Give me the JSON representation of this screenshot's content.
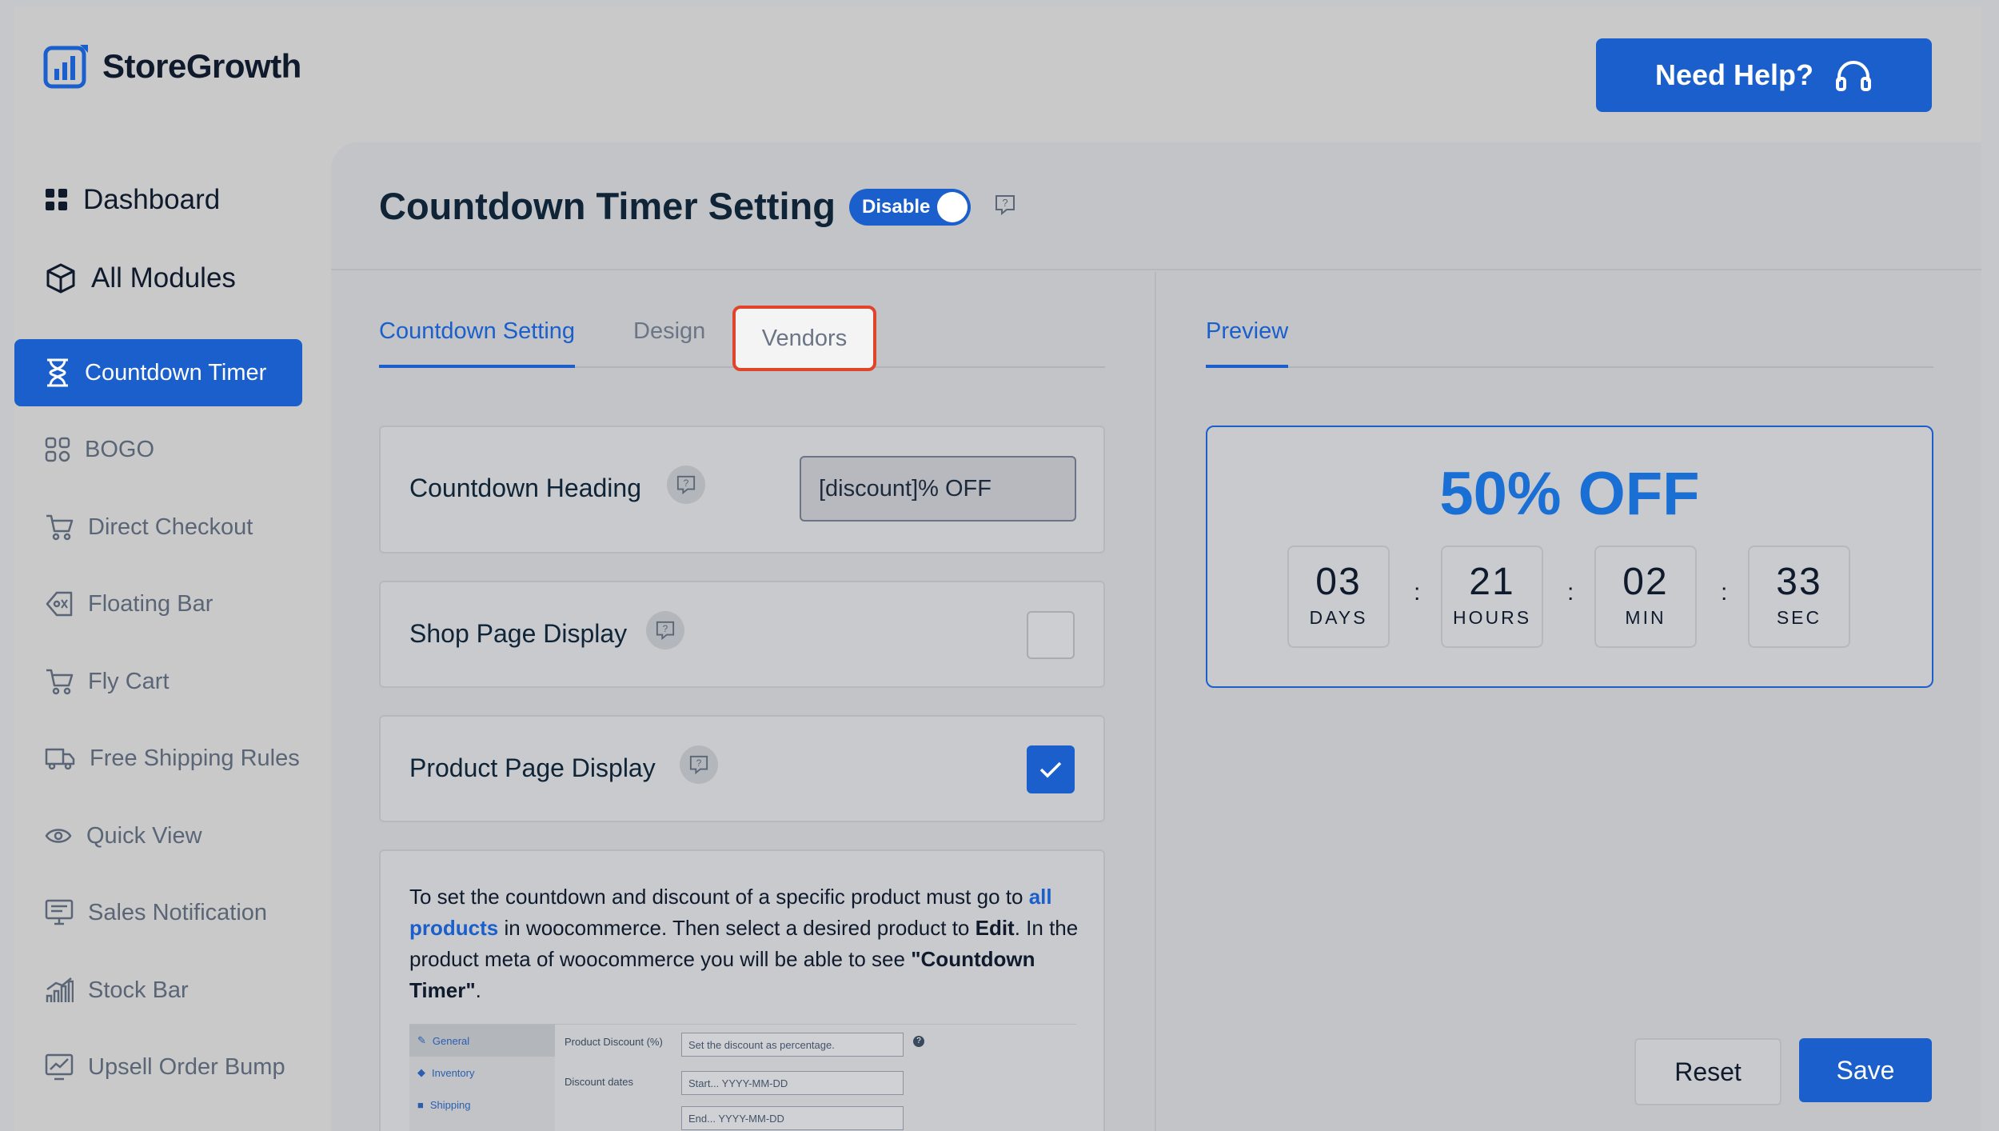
{
  "brand": {
    "name": "StoreGrowth",
    "accent": "#1a5fcc"
  },
  "header": {
    "help_label": "Need Help?"
  },
  "sidebar": {
    "top": [
      {
        "label": "Dashboard",
        "icon": "grid-icon"
      },
      {
        "label": "All Modules",
        "icon": "cube-icon"
      }
    ],
    "items": [
      {
        "label": "Countdown Timer",
        "icon": "hourglass-icon",
        "active": true
      },
      {
        "label": "BOGO",
        "icon": "bogo-icon"
      },
      {
        "label": "Direct Checkout",
        "icon": "cart-icon"
      },
      {
        "label": "Floating Bar",
        "icon": "tag-icon"
      },
      {
        "label": "Fly Cart",
        "icon": "cart-icon"
      },
      {
        "label": "Free Shipping Rules",
        "icon": "truck-icon"
      },
      {
        "label": "Quick View",
        "icon": "eye-icon"
      },
      {
        "label": "Sales Notification",
        "icon": "monitor-icon"
      },
      {
        "label": "Stock Bar",
        "icon": "bar-chart-icon"
      },
      {
        "label": "Upsell Order Bump",
        "icon": "chart-icon"
      }
    ]
  },
  "page": {
    "title": "Countdown Timer Setting",
    "toggle_label": "Disable"
  },
  "tabs": {
    "countdown_setting": "Countdown Setting",
    "design": "Design",
    "vendors": "Vendors"
  },
  "settings": {
    "heading_label": "Countdown Heading",
    "heading_value": "[discount]% OFF",
    "shop_label": "Shop Page Display",
    "shop_checked": false,
    "product_label": "Product Page Display",
    "product_checked": true
  },
  "info": {
    "p1": "To set the countdown and discount of a specific product must go to ",
    "link": "all products",
    "p2": " in woocommerce. Then select a desired product to ",
    "edit": "Edit",
    "p3": ". In the product meta of woocommerce you will be able to see ",
    "timer": "\"Countdown Timer\"",
    "p4": "."
  },
  "mini": {
    "tabs": [
      "General",
      "Inventory",
      "Shipping"
    ],
    "discount_label": "Product Discount (%)",
    "discount_placeholder": "Set the discount as percentage.",
    "dates_label": "Discount dates",
    "start_placeholder": "Start... YYYY-MM-DD",
    "end_placeholder": "End... YYYY-MM-DD"
  },
  "preview": {
    "tab": "Preview",
    "heading": "50% OFF",
    "sep": ":",
    "units": [
      {
        "value": "03",
        "label": "DAYS"
      },
      {
        "value": "21",
        "label": "HOURS"
      },
      {
        "value": "02",
        "label": "MIN"
      },
      {
        "value": "33",
        "label": "SEC"
      }
    ]
  },
  "actions": {
    "reset": "Reset",
    "save": "Save"
  }
}
